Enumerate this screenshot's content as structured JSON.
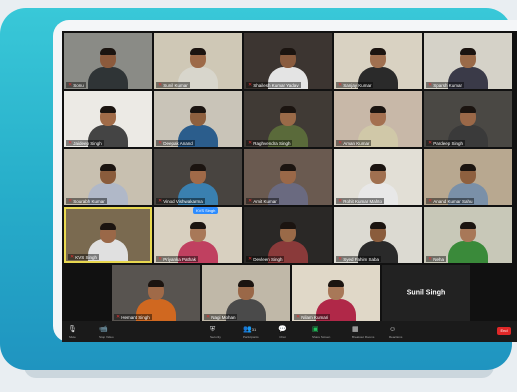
{
  "meeting": {
    "participants": [
      {
        "name": "Sonu",
        "wall": "#8a8b86",
        "skin": "#8c5a3c",
        "shirt": "#2f3436"
      },
      {
        "name": "Sunil Kumar",
        "wall": "#cfc8b6",
        "skin": "#9d6a48",
        "shirt": "#d8d6cc"
      },
      {
        "name": "Shailesh Kumar Yadav",
        "wall": "#3c3531",
        "skin": "#8a5c3f",
        "shirt": "#e4e4e4"
      },
      {
        "name": "Sanjay Kumar",
        "wall": "#d9d2c2",
        "skin": "#a07050",
        "shirt": "#2a2a2a"
      },
      {
        "name": "Sparsh Kumar",
        "wall": "#d5d2c8",
        "skin": "#9a6a48",
        "shirt": "#3a3a48"
      },
      {
        "name": "Jaideep Singh",
        "wall": "#eceae5",
        "skin": "#a06b48",
        "shirt": "#444"
      },
      {
        "name": "Deepak Anand",
        "wall": "#c9c4b8",
        "skin": "#8e603f",
        "shirt": "#2b5d8c"
      },
      {
        "name": "Raghvendra Singh",
        "wall": "#403a35",
        "skin": "#9a6a48",
        "shirt": "#5a6a3a"
      },
      {
        "name": "Aman Kumar",
        "wall": "#c8b8a8",
        "skin": "#a47050",
        "shirt": "#d0c8a8"
      },
      {
        "name": "Pardeep Singh",
        "wall": "#4a4844",
        "skin": "#9a6848",
        "shirt": "#3a3a3a"
      },
      {
        "name": "Sourabh Kumar",
        "wall": "#c8c0b0",
        "skin": "#8a5c3c",
        "shirt": "#b0b8c8"
      },
      {
        "name": "Vinod Vishwakarma",
        "wall": "#484440",
        "skin": "#a06a48",
        "shirt": "#3a80b0"
      },
      {
        "name": "Amit Kumar",
        "wall": "#6a5a50",
        "skin": "#9a6848",
        "shirt": "#6a6a80"
      },
      {
        "name": "Rohit Kumar Mahto",
        "wall": "#e2dfd6",
        "skin": "#a07050",
        "shirt": "#e8e8e8"
      },
      {
        "name": "Anand Kumar Sahu",
        "wall": "#b8a890",
        "skin": "#8e603f",
        "shirt": "#7a90a8"
      },
      {
        "name": "KVS Singh",
        "wall": "#7a6a50",
        "skin": "#9a6848",
        "shirt": "#e0e0e0",
        "active": true
      },
      {
        "name": "Priyanka Pathak",
        "wall": "#d8d0c0",
        "skin": "#a87858",
        "shirt": "#c04060"
      },
      {
        "name": "Devleen Singh",
        "wall": "#2a2826",
        "skin": "#9a6a48",
        "shirt": "#8a3a3a"
      },
      {
        "name": "Syed Fahim Saba",
        "wall": "#dcdad2",
        "skin": "#8a5c3c",
        "shirt": "#2a2a2a"
      },
      {
        "name": "Neha",
        "wall": "#c8c8b8",
        "skin": "#a87858",
        "shirt": "#3a8a3a"
      },
      {
        "name": "Hemant Singh",
        "wall": "#585450",
        "skin": "#a06a48",
        "shirt": "#d06820"
      },
      {
        "name": "Nagi Mohan",
        "wall": "#c0b8a8",
        "skin": "#9a6848",
        "shirt": "#4a4a4a"
      },
      {
        "name": "Nilam Kumari",
        "wall": "#e0d8c8",
        "skin": "#a87858",
        "shirt": "#b02848"
      },
      {
        "name": "Sunil Singh",
        "text_only": true
      }
    ],
    "tooltip": "KVS Singh"
  },
  "toolbar": {
    "mute_label": "Mute",
    "video_label": "Stop Video",
    "security_label": "Security",
    "participants_label": "Participants",
    "participants_count": "31",
    "chat_label": "Chat",
    "share_label": "Share Screen",
    "breakout_label": "Breakout Rooms",
    "reactions_label": "Reactions",
    "end_label": "End"
  }
}
